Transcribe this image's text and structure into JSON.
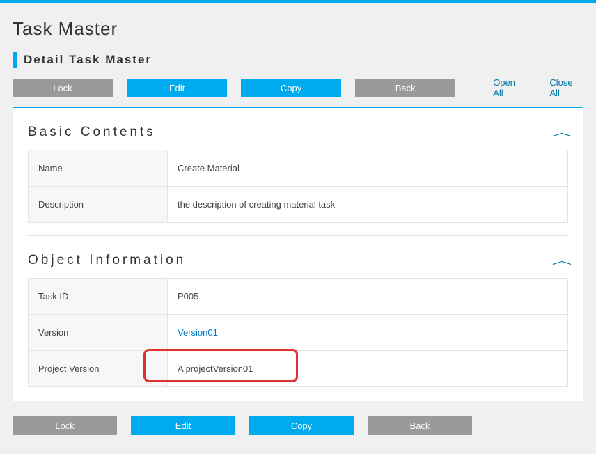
{
  "page": {
    "title": "Task Master",
    "subtitle": "Detail Task Master"
  },
  "toolbar": {
    "lock": "Lock",
    "edit": "Edit",
    "copy": "Copy",
    "back": "Back",
    "open_all": "Open All",
    "close_all": "Close All"
  },
  "sections": {
    "basic": {
      "title": "Basic Contents",
      "rows": {
        "name_label": "Name",
        "name_value": "Create Material",
        "desc_label": "Description",
        "desc_value": "the description of creating material task"
      }
    },
    "object": {
      "title": "Object Information",
      "rows": {
        "taskid_label": "Task ID",
        "taskid_value": "P005",
        "version_label": "Version",
        "version_value": "Version01",
        "projver_label": "Project Version",
        "projver_value": "A projectVersion01"
      }
    }
  }
}
